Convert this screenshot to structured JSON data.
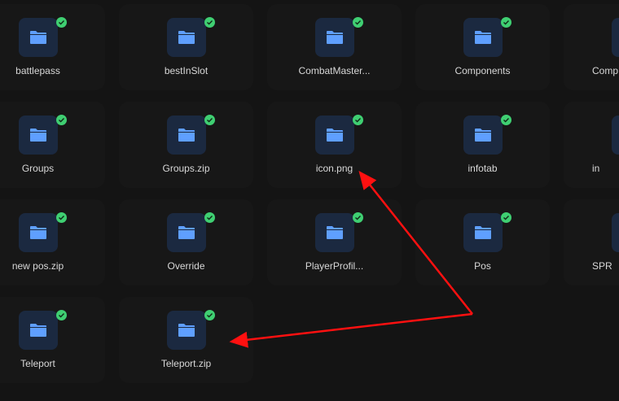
{
  "items": [
    {
      "name": "battlepass",
      "synced": true
    },
    {
      "name": "bestInSlot",
      "synced": true
    },
    {
      "name": "CombatMaster...",
      "synced": true
    },
    {
      "name": "Components",
      "synced": true
    },
    {
      "name": "Comp",
      "synced": false
    },
    {
      "name": "Groups",
      "synced": true
    },
    {
      "name": "Groups.zip",
      "synced": true
    },
    {
      "name": "icon.png",
      "synced": true
    },
    {
      "name": "infotab",
      "synced": true
    },
    {
      "name": "in",
      "synced": false
    },
    {
      "name": "new pos.zip",
      "synced": true
    },
    {
      "name": "Override",
      "synced": true
    },
    {
      "name": "PlayerProfil...",
      "synced": true
    },
    {
      "name": "Pos",
      "synced": true
    },
    {
      "name": "SPR",
      "synced": false
    },
    {
      "name": "Teleport",
      "synced": true
    },
    {
      "name": "Teleport.zip",
      "synced": true
    }
  ],
  "colors": {
    "annotation": "#ff1010",
    "folder": "#5f9fff",
    "check": "#3fcf72"
  }
}
